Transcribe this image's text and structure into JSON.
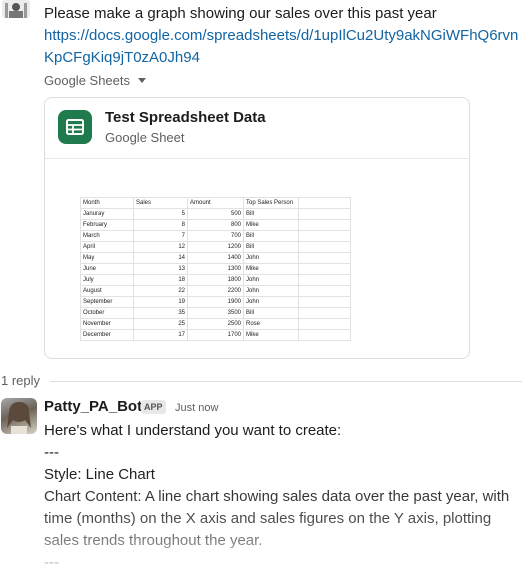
{
  "message1": {
    "text": "Please make a graph showing our sales over this past year",
    "link": "https://docs.google.com/spreadsheets/d/1upIlCu2Uty9akNGiWFhQ6rvnKpCFgKiq9jT0zA0Jh94"
  },
  "unfurl": {
    "source_label": "Google Sheets",
    "card_title": "Test Spreadsheet Data",
    "card_subtitle": "Google Sheet",
    "icon": "google-sheets-icon",
    "icon_color": "#1f7a4e"
  },
  "sheet": {
    "headers": [
      "Month",
      "Sales",
      "Amount",
      "Top Sales Person"
    ],
    "rows": [
      [
        "Januray",
        "5",
        "500",
        "Bill"
      ],
      [
        "February",
        "8",
        "800",
        "Mike"
      ],
      [
        "March",
        "7",
        "700",
        "Bill"
      ],
      [
        "April",
        "12",
        "1200",
        "Bill"
      ],
      [
        "May",
        "14",
        "1400",
        "John"
      ],
      [
        "June",
        "13",
        "1300",
        "Mike"
      ],
      [
        "July",
        "18",
        "1800",
        "John"
      ],
      [
        "August",
        "22",
        "2200",
        "John"
      ],
      [
        "September",
        "19",
        "1900",
        "John"
      ],
      [
        "October",
        "35",
        "3500",
        "Bill"
      ],
      [
        "November",
        "25",
        "2500",
        "Rose"
      ],
      [
        "December",
        "17",
        "1700",
        "Mike"
      ]
    ]
  },
  "thread": {
    "reply_count": "1 reply"
  },
  "bot_message": {
    "name": "Patty_PA_Bot",
    "badge": "APP",
    "time": "Just now",
    "lines": [
      "Here's what I understand you want to create:",
      "---",
      "Style: Line Chart",
      "Chart Content: A line chart showing sales data over the past year, with time (months) on the X axis and sales figures on the Y axis, plotting sales trends throughout the year.",
      "---"
    ]
  },
  "colors": {
    "link": "#1264a3",
    "text": "#1d1c1d",
    "muted": "#616061"
  }
}
